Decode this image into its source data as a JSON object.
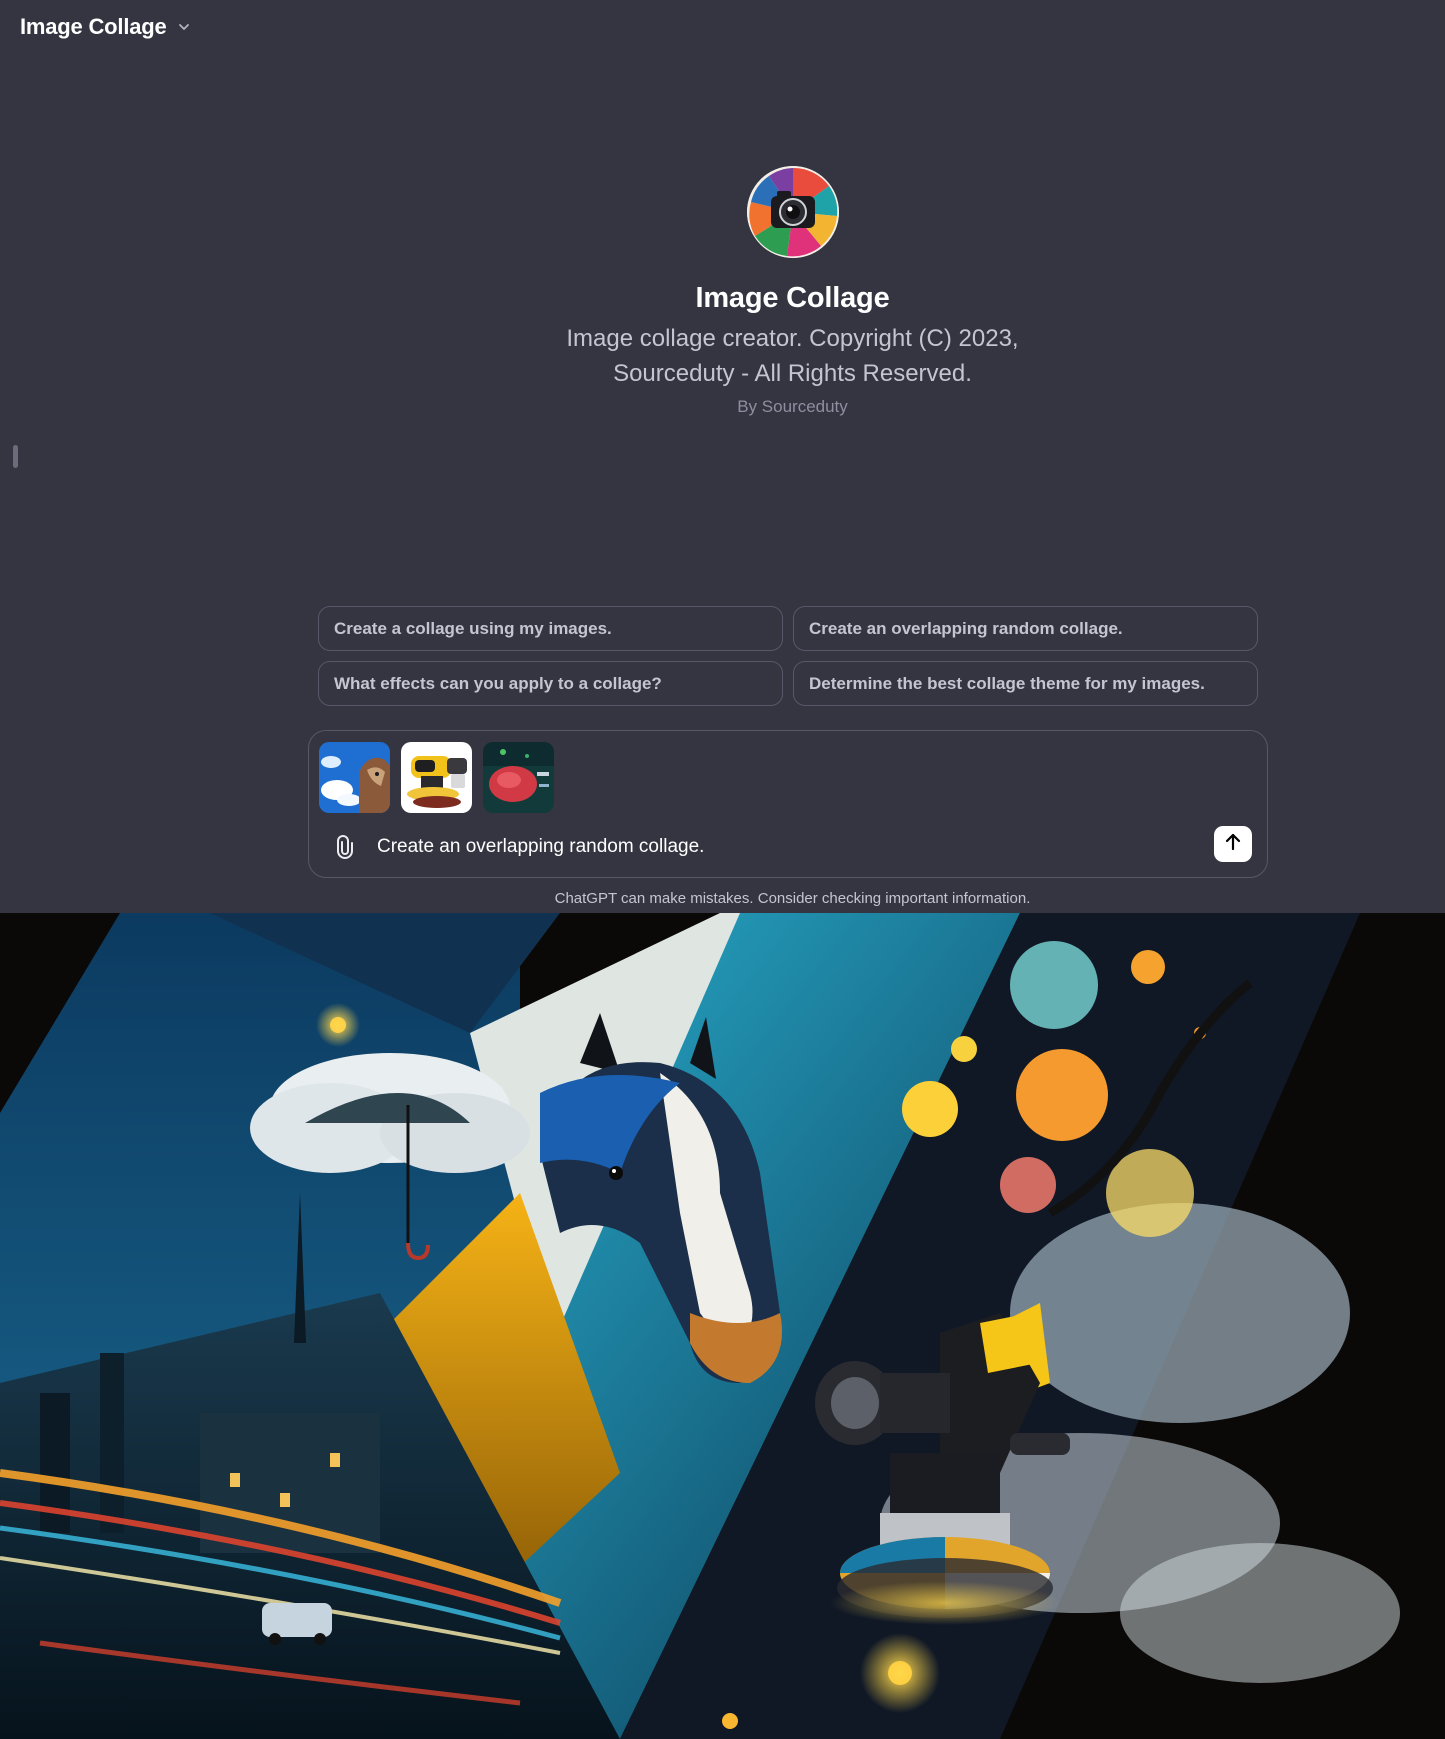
{
  "header": {
    "title": "Image Collage"
  },
  "gpt": {
    "name": "Image Collage",
    "description": "Image collage creator. Copyright (C) 2023, Sourceduty - All Rights Reserved.",
    "author": "By Sourceduty"
  },
  "suggestions": [
    "Create a collage using my images.",
    "Create an overlapping random collage.",
    "What effects can you apply to a collage?",
    "Determine the best collage theme for my images."
  ],
  "composer": {
    "value": "Create an overlapping random collage.",
    "attachments": [
      "image-thumbnail",
      "image-thumbnail",
      "image-thumbnail"
    ]
  },
  "disclaimer": "ChatGPT can make mistakes. Consider checking important information.",
  "colors": {
    "background": "#343541",
    "border": "#565869",
    "text": "#ececf1",
    "muted": "#c5c5d2",
    "accent_yellow": "#f5c518",
    "accent_blue": "#1b6fa8"
  },
  "icons": {
    "header_chevron": "chevron-down-icon",
    "attach": "paperclip-icon",
    "send": "arrow-up-icon"
  }
}
